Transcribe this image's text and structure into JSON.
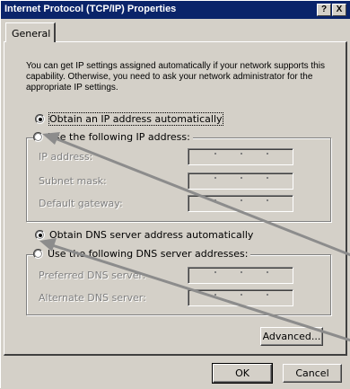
{
  "window": {
    "title": "Internet Protocol (TCP/IP) Properties",
    "help_label": "?",
    "close_label": "X"
  },
  "tabs": [
    "General"
  ],
  "intro_text": "You can get IP settings assigned automatically if your network supports this capability. Otherwise, you need to ask your network administrator for the appropriate IP settings.",
  "ip_section": {
    "auto_label": "Obtain an IP address automatically",
    "auto_selected": true,
    "manual_label": "Use the following IP address:",
    "fields": [
      "IP address:",
      "Subnet mask:",
      "Default gateway:"
    ]
  },
  "dns_section": {
    "auto_label": "Obtain DNS server address automatically",
    "auto_selected": true,
    "manual_label": "Use the following DNS server addresses:",
    "fields": [
      "Preferred DNS server:",
      "Alternate DNS server:"
    ]
  },
  "buttons": {
    "advanced": "Advanced...",
    "ok": "OK",
    "cancel": "Cancel"
  },
  "colors": {
    "titlebar": "#0a246a",
    "face": "#d4d0c8",
    "arrow": "#8c8c8c"
  }
}
